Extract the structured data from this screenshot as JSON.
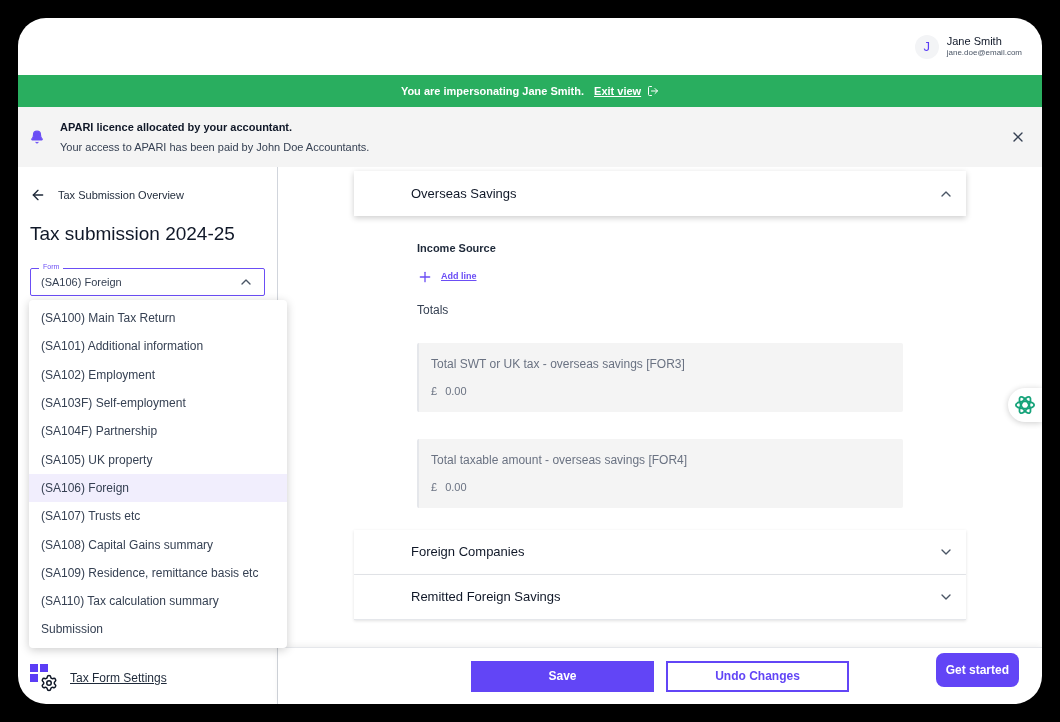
{
  "user": {
    "initial": "J",
    "name": "Jane Smith",
    "email": "jane.doe@email.com"
  },
  "impersonation_banner": {
    "text": "You are impersonating Jane Smith.",
    "link": "Exit view"
  },
  "notice": {
    "title": "APARI licence allocated by your accountant.",
    "body": "Your access to APARI has been paid by John Doe Accountants."
  },
  "sidebar": {
    "back_link": "Tax Submission Overview",
    "title": "Tax submission 2024-25",
    "form_select": {
      "label": "Form",
      "value": "(SA106) Foreign",
      "expanded": true
    },
    "settings_link": "Tax Form Settings"
  },
  "form_options": [
    {
      "label": "(SA100) Main Tax Return",
      "selected": false
    },
    {
      "label": "(SA101) Additional information",
      "selected": false
    },
    {
      "label": "(SA102) Employment",
      "selected": false
    },
    {
      "label": "(SA103F) Self-employment",
      "selected": false
    },
    {
      "label": "(SA104F) Partnership",
      "selected": false
    },
    {
      "label": "(SA105) UK property",
      "selected": false
    },
    {
      "label": "(SA106) Foreign",
      "selected": true
    },
    {
      "label": "(SA107) Trusts etc",
      "selected": false
    },
    {
      "label": "(SA108) Capital Gains summary",
      "selected": false
    },
    {
      "label": "(SA109) Residence, remittance basis etc",
      "selected": false
    },
    {
      "label": "(SA110) Tax calculation summary",
      "selected": false
    },
    {
      "label": "Submission",
      "selected": false
    }
  ],
  "sections": [
    {
      "title": "Overseas Savings",
      "expanded": true,
      "subheading": "Income Source",
      "add_line": "Add line",
      "totals_label": "Totals",
      "fields": [
        {
          "label": "Total SWT or UK tax - overseas savings [FOR3]",
          "currency": "£",
          "placeholder": "0.00"
        },
        {
          "label": "Total taxable amount - overseas savings [FOR4]",
          "currency": "£",
          "placeholder": "0.00"
        }
      ]
    },
    {
      "title": "Foreign Companies",
      "expanded": false
    },
    {
      "title": "Remitted Foreign Savings",
      "expanded": false
    }
  ],
  "footer": {
    "save": "Save",
    "undo": "Undo Changes"
  },
  "get_started": "Get started"
}
